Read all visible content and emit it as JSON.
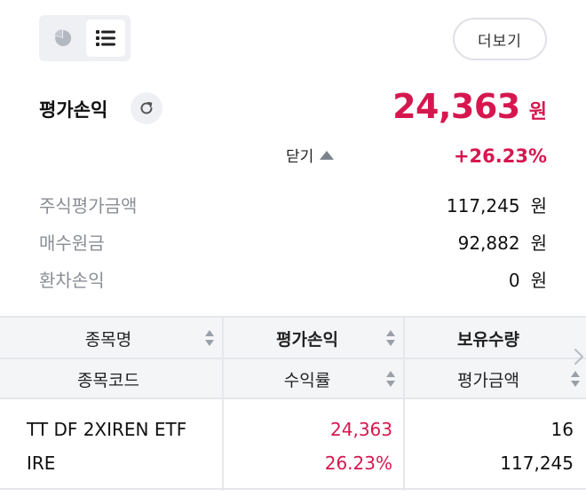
{
  "toolbar": {
    "view_toggle": [
      "pie-chart-view",
      "list-view"
    ],
    "selected_view": "list-view",
    "more_label": "더보기"
  },
  "summary": {
    "title": "평가손익",
    "pnl_value": "24,363",
    "pnl_unit": "원",
    "collapse_label": "닫기",
    "pnl_rate": "+26.23%",
    "rows": [
      {
        "label": "주식평가금액",
        "value": "117,245",
        "unit": "원"
      },
      {
        "label": "매수원금",
        "value": "92,882",
        "unit": "원"
      },
      {
        "label": "환차손익",
        "value": "0",
        "unit": "원"
      }
    ]
  },
  "table": {
    "headers": [
      [
        "종목명",
        "평가손익",
        "보유수량"
      ],
      [
        "종목코드",
        "수익률",
        "평가금액"
      ]
    ],
    "rows": [
      {
        "name": "TT DF 2XIREN ETF",
        "code": "IRE",
        "pnl": "24,363",
        "rate": "26.23%",
        "quantity": "16",
        "eval_amount": "117,245"
      }
    ]
  },
  "colors": {
    "accent_red": "#d6174f",
    "label_gray": "#8a8d93",
    "header_bg": "#f4f5f7"
  }
}
